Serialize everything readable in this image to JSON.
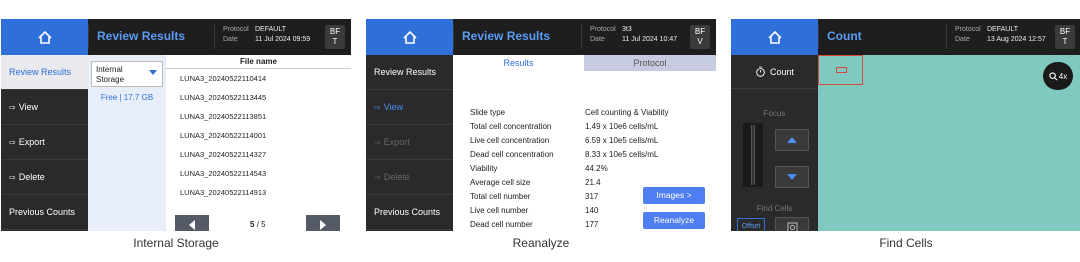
{
  "colors": {
    "accent": "#2e6fd8",
    "header_bg": "#1e1e1e",
    "sidebar_bg": "#2a2a2a",
    "button_blue": "#4f7ef2",
    "field": "#7fc9c0",
    "roi": "#d54a3a"
  },
  "screens": [
    {
      "caption": "Internal Storage",
      "header": {
        "title": "Review Results",
        "protocol_label": "Protocol",
        "protocol_value": "DEFAULT",
        "date_label": "Date",
        "date_value": "11 Jul 2024 09:59",
        "bf_top": "BF",
        "bf_bottom": "T"
      },
      "sidebar": [
        {
          "label": "Review Results",
          "icon": ""
        },
        {
          "label": "View",
          "icon": "arrow-right-icon"
        },
        {
          "label": "Export",
          "icon": "arrow-right-icon"
        },
        {
          "label": "Delete",
          "icon": "arrow-right-icon"
        },
        {
          "label": "Previous Counts",
          "icon": ""
        }
      ],
      "storage": {
        "line1": "Internal",
        "line2": "Storage",
        "free": "Free | 17.7 GB"
      },
      "file_header": "File name",
      "files": [
        "LUNA3_20240522110414",
        "LUNA3_20240522113445",
        "LUNA3_20240522113851",
        "LUNA3_20240522114001",
        "LUNA3_20240522114327",
        "LUNA3_20240522114543",
        "LUNA3_20240522114913"
      ],
      "page_current": "5",
      "page_total": "/ 5"
    },
    {
      "caption": "Reanalyze",
      "header": {
        "title": "Review Results",
        "protocol_label": "Protocol",
        "protocol_value": "3t3",
        "date_label": "Date",
        "date_value": "11 Jul 2024 10:47",
        "bf_top": "BF",
        "bf_bottom": "V"
      },
      "sidebar": [
        {
          "label": "Review Results",
          "icon": ""
        },
        {
          "label": "View",
          "icon": "arrow-right-icon"
        },
        {
          "label": "Export",
          "icon": "arrow-right-icon"
        },
        {
          "label": "Delete",
          "icon": "arrow-right-icon"
        },
        {
          "label": "Previous Counts",
          "icon": ""
        }
      ],
      "tabs": [
        "Results",
        "Protocol"
      ],
      "results": [
        {
          "k": "Slide type",
          "v": "Cell counting & Viability"
        },
        {
          "k": "Total cell concentration",
          "v": "1.49 x 10e6 cells/mL"
        },
        {
          "k": "Live cell concentration",
          "v": "6.59 x 10e5 cells/mL"
        },
        {
          "k": "Dead cell concentration",
          "v": "8.33 x 10e5 cells/mL"
        },
        {
          "k": "Viability",
          "v": "44.2%"
        },
        {
          "k": "Average cell size",
          "v": "21.4"
        },
        {
          "k": "Total cell number",
          "v": "317"
        },
        {
          "k": "Live cell number",
          "v": "140"
        },
        {
          "k": "Dead cell number",
          "v": "177"
        }
      ],
      "images_button": "Images >",
      "reanalyze_button": "Reanalyze"
    },
    {
      "caption": "Find Cells",
      "header": {
        "title": "Count",
        "protocol_label": "Protocol",
        "protocol_value": "DEFAULT",
        "date_label": "Date",
        "date_value": "13 Aug 2024 12:57",
        "bf_top": "BF",
        "bf_bottom": "T"
      },
      "count_label": "Count",
      "focus_label": "Focus",
      "find_cells_label": "Find Cells",
      "offset_label": "Offset",
      "zoom_label": "4x"
    }
  ]
}
